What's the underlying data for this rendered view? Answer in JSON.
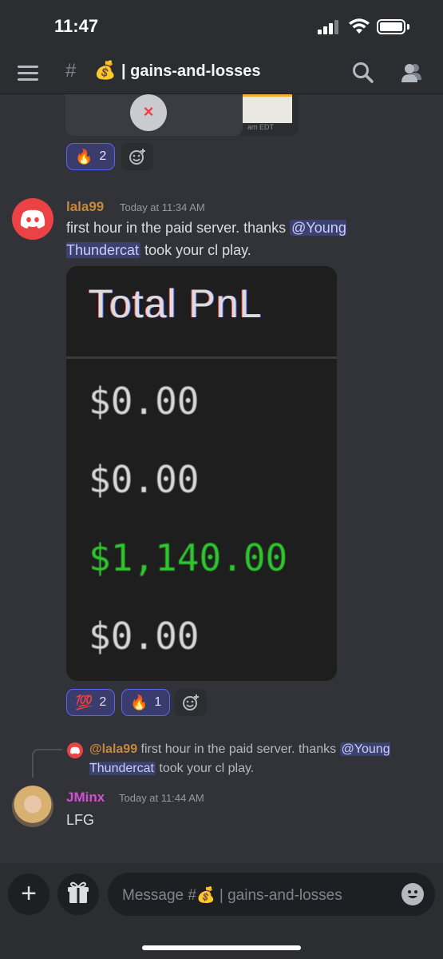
{
  "status_bar": {
    "time": "11:47"
  },
  "header": {
    "hash": "#",
    "channel_emoji": "💰",
    "channel_name": "| gains-and-losses"
  },
  "top_embed": {
    "footer": "am EDT",
    "remove_icon": "×"
  },
  "top_reactions": [
    {
      "emoji": "🔥",
      "count": "2"
    }
  ],
  "messages": [
    {
      "author": "lala99",
      "author_color": "#c7883a",
      "timestamp": "Today at 11:34 AM",
      "text_pre": "first hour in the paid server. thanks ",
      "mention": "@Young Thundercat",
      "text_post": " took your cl play.",
      "image": {
        "title": "Total PnL",
        "values": [
          "$0.00",
          "$0.00",
          "$1,140.00",
          "$0.00"
        ]
      },
      "reactions": [
        {
          "emoji": "💯",
          "count": "2"
        },
        {
          "emoji": "🔥",
          "count": "1"
        }
      ]
    },
    {
      "reply": {
        "author": "@lala99",
        "text_pre": "first hour in the paid server. thanks ",
        "mention": "@Young Thundercat",
        "text_post": " took your cl play."
      },
      "author": "JMinx",
      "author_color": "#d44fd4",
      "timestamp": "Today at 11:44 AM",
      "text": "LFG"
    }
  ],
  "composer": {
    "plus_label": "+",
    "placeholder_pre": "Message #",
    "placeholder_emoji": "💰",
    "placeholder_post": " | gains-and-losses"
  },
  "colors": {
    "accent": "#5865f2",
    "pnl_positive": "#2ec62e",
    "mention_bg": "#3c4270"
  }
}
